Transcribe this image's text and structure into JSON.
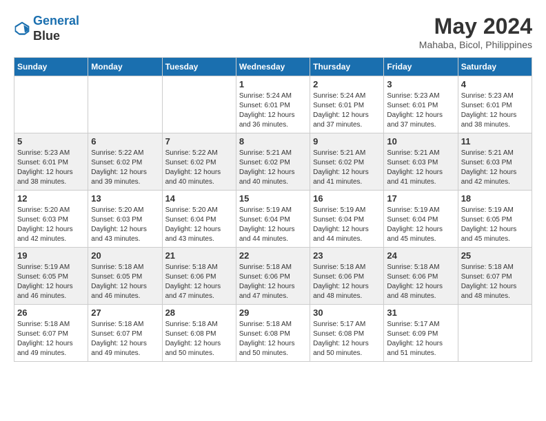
{
  "logo": {
    "line1": "General",
    "line2": "Blue"
  },
  "title": {
    "month_year": "May 2024",
    "location": "Mahaba, Bicol, Philippines"
  },
  "weekdays": [
    "Sunday",
    "Monday",
    "Tuesday",
    "Wednesday",
    "Thursday",
    "Friday",
    "Saturday"
  ],
  "weeks": [
    [
      {
        "day": "",
        "info": ""
      },
      {
        "day": "",
        "info": ""
      },
      {
        "day": "",
        "info": ""
      },
      {
        "day": "1",
        "info": "Sunrise: 5:24 AM\nSunset: 6:01 PM\nDaylight: 12 hours\nand 36 minutes."
      },
      {
        "day": "2",
        "info": "Sunrise: 5:24 AM\nSunset: 6:01 PM\nDaylight: 12 hours\nand 37 minutes."
      },
      {
        "day": "3",
        "info": "Sunrise: 5:23 AM\nSunset: 6:01 PM\nDaylight: 12 hours\nand 37 minutes."
      },
      {
        "day": "4",
        "info": "Sunrise: 5:23 AM\nSunset: 6:01 PM\nDaylight: 12 hours\nand 38 minutes."
      }
    ],
    [
      {
        "day": "5",
        "info": "Sunrise: 5:23 AM\nSunset: 6:01 PM\nDaylight: 12 hours\nand 38 minutes."
      },
      {
        "day": "6",
        "info": "Sunrise: 5:22 AM\nSunset: 6:02 PM\nDaylight: 12 hours\nand 39 minutes."
      },
      {
        "day": "7",
        "info": "Sunrise: 5:22 AM\nSunset: 6:02 PM\nDaylight: 12 hours\nand 40 minutes."
      },
      {
        "day": "8",
        "info": "Sunrise: 5:21 AM\nSunset: 6:02 PM\nDaylight: 12 hours\nand 40 minutes."
      },
      {
        "day": "9",
        "info": "Sunrise: 5:21 AM\nSunset: 6:02 PM\nDaylight: 12 hours\nand 41 minutes."
      },
      {
        "day": "10",
        "info": "Sunrise: 5:21 AM\nSunset: 6:03 PM\nDaylight: 12 hours\nand 41 minutes."
      },
      {
        "day": "11",
        "info": "Sunrise: 5:21 AM\nSunset: 6:03 PM\nDaylight: 12 hours\nand 42 minutes."
      }
    ],
    [
      {
        "day": "12",
        "info": "Sunrise: 5:20 AM\nSunset: 6:03 PM\nDaylight: 12 hours\nand 42 minutes."
      },
      {
        "day": "13",
        "info": "Sunrise: 5:20 AM\nSunset: 6:03 PM\nDaylight: 12 hours\nand 43 minutes."
      },
      {
        "day": "14",
        "info": "Sunrise: 5:20 AM\nSunset: 6:04 PM\nDaylight: 12 hours\nand 43 minutes."
      },
      {
        "day": "15",
        "info": "Sunrise: 5:19 AM\nSunset: 6:04 PM\nDaylight: 12 hours\nand 44 minutes."
      },
      {
        "day": "16",
        "info": "Sunrise: 5:19 AM\nSunset: 6:04 PM\nDaylight: 12 hours\nand 44 minutes."
      },
      {
        "day": "17",
        "info": "Sunrise: 5:19 AM\nSunset: 6:04 PM\nDaylight: 12 hours\nand 45 minutes."
      },
      {
        "day": "18",
        "info": "Sunrise: 5:19 AM\nSunset: 6:05 PM\nDaylight: 12 hours\nand 45 minutes."
      }
    ],
    [
      {
        "day": "19",
        "info": "Sunrise: 5:19 AM\nSunset: 6:05 PM\nDaylight: 12 hours\nand 46 minutes."
      },
      {
        "day": "20",
        "info": "Sunrise: 5:18 AM\nSunset: 6:05 PM\nDaylight: 12 hours\nand 46 minutes."
      },
      {
        "day": "21",
        "info": "Sunrise: 5:18 AM\nSunset: 6:06 PM\nDaylight: 12 hours\nand 47 minutes."
      },
      {
        "day": "22",
        "info": "Sunrise: 5:18 AM\nSunset: 6:06 PM\nDaylight: 12 hours\nand 47 minutes."
      },
      {
        "day": "23",
        "info": "Sunrise: 5:18 AM\nSunset: 6:06 PM\nDaylight: 12 hours\nand 48 minutes."
      },
      {
        "day": "24",
        "info": "Sunrise: 5:18 AM\nSunset: 6:06 PM\nDaylight: 12 hours\nand 48 minutes."
      },
      {
        "day": "25",
        "info": "Sunrise: 5:18 AM\nSunset: 6:07 PM\nDaylight: 12 hours\nand 48 minutes."
      }
    ],
    [
      {
        "day": "26",
        "info": "Sunrise: 5:18 AM\nSunset: 6:07 PM\nDaylight: 12 hours\nand 49 minutes."
      },
      {
        "day": "27",
        "info": "Sunrise: 5:18 AM\nSunset: 6:07 PM\nDaylight: 12 hours\nand 49 minutes."
      },
      {
        "day": "28",
        "info": "Sunrise: 5:18 AM\nSunset: 6:08 PM\nDaylight: 12 hours\nand 50 minutes."
      },
      {
        "day": "29",
        "info": "Sunrise: 5:18 AM\nSunset: 6:08 PM\nDaylight: 12 hours\nand 50 minutes."
      },
      {
        "day": "30",
        "info": "Sunrise: 5:17 AM\nSunset: 6:08 PM\nDaylight: 12 hours\nand 50 minutes."
      },
      {
        "day": "31",
        "info": "Sunrise: 5:17 AM\nSunset: 6:09 PM\nDaylight: 12 hours\nand 51 minutes."
      },
      {
        "day": "",
        "info": ""
      }
    ]
  ]
}
